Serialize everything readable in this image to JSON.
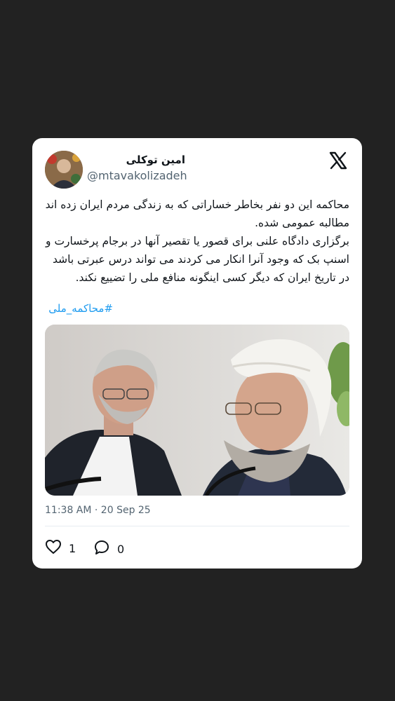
{
  "author": {
    "display_name": "امین توکلی",
    "handle": "@mtavakolizadeh"
  },
  "brand_icon": "x-logo-icon",
  "tweet": {
    "paragraph1": "محاکمه این دو نفر بخاطر خساراتی که به زندگی مردم ایران زده اند مطالبه عمومی شده.",
    "paragraph2": "برگزاری دادگاه علنی برای قصور یا تقصیر آنها در  برجام پرخسارت و اسنپ بک که وجود آنرا انکار می کردند می تواند درس عبرتی باشد در تاریخ ایران که دیگر کسی اینگونه منافع ملی را تضییع نکند.",
    "hashtag": "#محاکمه_ملی",
    "timestamp": "11:38 AM · 20 Sep 25"
  },
  "actions": {
    "likes": "1",
    "replies": "0",
    "like_icon": "heart-icon",
    "reply_icon": "reply-icon"
  },
  "colors": {
    "background": "#222222",
    "card": "#ffffff",
    "link": "#1d9bf0",
    "muted": "#536471"
  }
}
